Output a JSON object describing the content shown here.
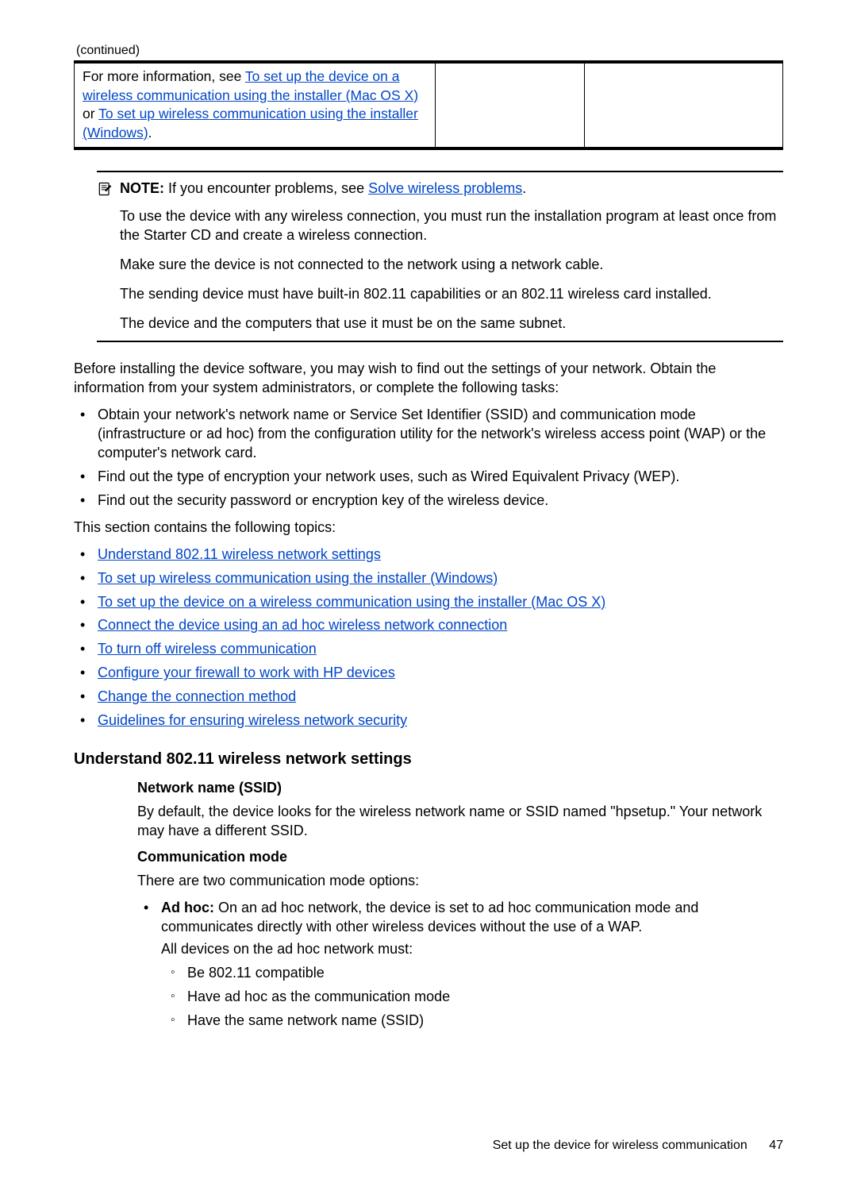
{
  "continued": "(continued)",
  "table_cell_prefix": "For more information, see ",
  "table_link1": "To set up the device on a wireless communication using the installer (Mac OS X)",
  "table_cell_mid": " or ",
  "table_link2": "To set up wireless communication using the installer (Windows)",
  "table_cell_suffix": ".",
  "note": {
    "label": "NOTE:",
    "lead": "  If you encounter problems, see ",
    "lead_link": "Solve wireless problems",
    "lead_suffix": ".",
    "p1": "To use the device with any wireless connection, you must run the installation program at least once from the Starter CD and create a wireless connection.",
    "p2": "Make sure the device is not connected to the network using a network cable.",
    "p3": "The sending device must have built-in 802.11 capabilities or an 802.11 wireless card installed.",
    "p4": "The device and the computers that use it must be on the same subnet."
  },
  "before_para": "Before installing the device software, you may wish to find out the settings of your network. Obtain the information from your system administrators, or complete the following tasks:",
  "tasks": [
    "Obtain your network's network name or Service Set Identifier (SSID) and communication mode (infrastructure or ad hoc) from the configuration utility for the network's wireless access point (WAP) or the computer's network card.",
    "Find out the type of encryption your network uses, such as Wired Equivalent Privacy (WEP).",
    "Find out the security password or encryption key of the wireless device."
  ],
  "section_intro": "This section contains the following topics:",
  "topic_links": [
    "Understand 802.11 wireless network settings",
    "To set up wireless communication using the installer (Windows)",
    "To set up the device on a wireless communication using the installer (Mac OS X)",
    "Connect the device using an ad hoc wireless network connection",
    "To turn off wireless communication",
    "Configure your firewall to work with HP devices",
    "Change the connection method",
    "Guidelines for ensuring wireless network security"
  ],
  "h1": "Understand 802.11 wireless network settings",
  "ssid_h": "Network name (SSID)",
  "ssid_p": "By default, the device looks for the wireless network name or SSID named \"hpsetup.\" Your network may have a different SSID.",
  "comm_h": "Communication mode",
  "comm_p": "There are two communication mode options:",
  "adhoc_label": "Ad hoc:",
  "adhoc_text": " On an ad hoc network, the device is set to ad hoc communication mode and communicates directly with other wireless devices without the use of a WAP.",
  "adhoc_sub_intro": "All devices on the ad hoc network must:",
  "adhoc_subs": [
    "Be 802.11 compatible",
    "Have ad hoc as the communication mode",
    "Have the same network name (SSID)"
  ],
  "footer_title": "Set up the device for wireless communication",
  "footer_page": "47"
}
